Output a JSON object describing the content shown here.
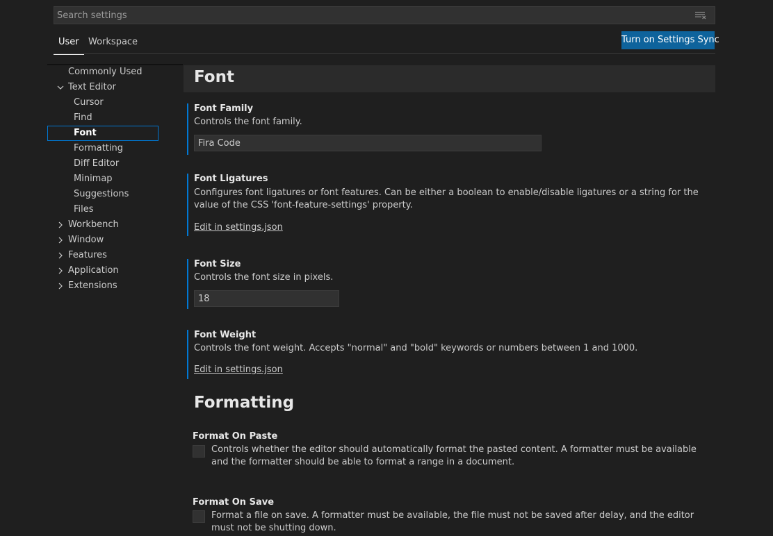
{
  "search": {
    "placeholder": "Search settings",
    "icon": "filter-icon"
  },
  "tabs": [
    {
      "label": "User",
      "active": true
    },
    {
      "label": "Workspace",
      "active": false
    }
  ],
  "sync_button_label": "Turn on Settings Sync",
  "toc": {
    "items": [
      {
        "label": "Commonly Used"
      },
      {
        "label": "Text Editor",
        "expanded": true
      },
      {
        "label": "Cursor"
      },
      {
        "label": "Find"
      },
      {
        "label": "Font",
        "selected": true
      },
      {
        "label": "Formatting"
      },
      {
        "label": "Diff Editor"
      },
      {
        "label": "Minimap"
      },
      {
        "label": "Suggestions"
      },
      {
        "label": "Files"
      },
      {
        "label": "Workbench",
        "expanded": false
      },
      {
        "label": "Window",
        "expanded": false
      },
      {
        "label": "Features",
        "expanded": false
      },
      {
        "label": "Application",
        "expanded": false
      },
      {
        "label": "Extensions",
        "expanded": false
      }
    ]
  },
  "font_section": {
    "title": "Font",
    "settings": {
      "font_family": {
        "title": "Font Family",
        "description": "Controls the font family.",
        "value": "Fira Code"
      },
      "font_ligatures": {
        "title": "Font Ligatures",
        "description": "Configures font ligatures or font features. Can be either a boolean to enable/disable ligatures or a string for the value of the CSS 'font-feature-settings' property.",
        "link": "Edit in settings.json"
      },
      "font_size": {
        "title": "Font Size",
        "description": "Controls the font size in pixels.",
        "value": "18"
      },
      "font_weight": {
        "title": "Font Weight",
        "description": "Controls the font weight. Accepts \"normal\" and \"bold\" keywords or numbers between 1 and 1000.",
        "link": "Edit in settings.json"
      }
    }
  },
  "formatting_section": {
    "title": "Formatting",
    "settings": {
      "format_on_paste": {
        "title": "Format On Paste",
        "description": "Controls whether the editor should automatically format the pasted content. A formatter must be available and the formatter should be able to format a range in a document.",
        "checked": false
      },
      "format_on_save": {
        "title": "Format On Save",
        "description": "Format a file on save. A formatter must be available, the file must not be saved after delay, and the editor must not be shutting down.",
        "checked": false
      }
    }
  },
  "colors": {
    "accent": "#0078d4",
    "button": "#0e639c",
    "background": "#1f1f1f"
  }
}
